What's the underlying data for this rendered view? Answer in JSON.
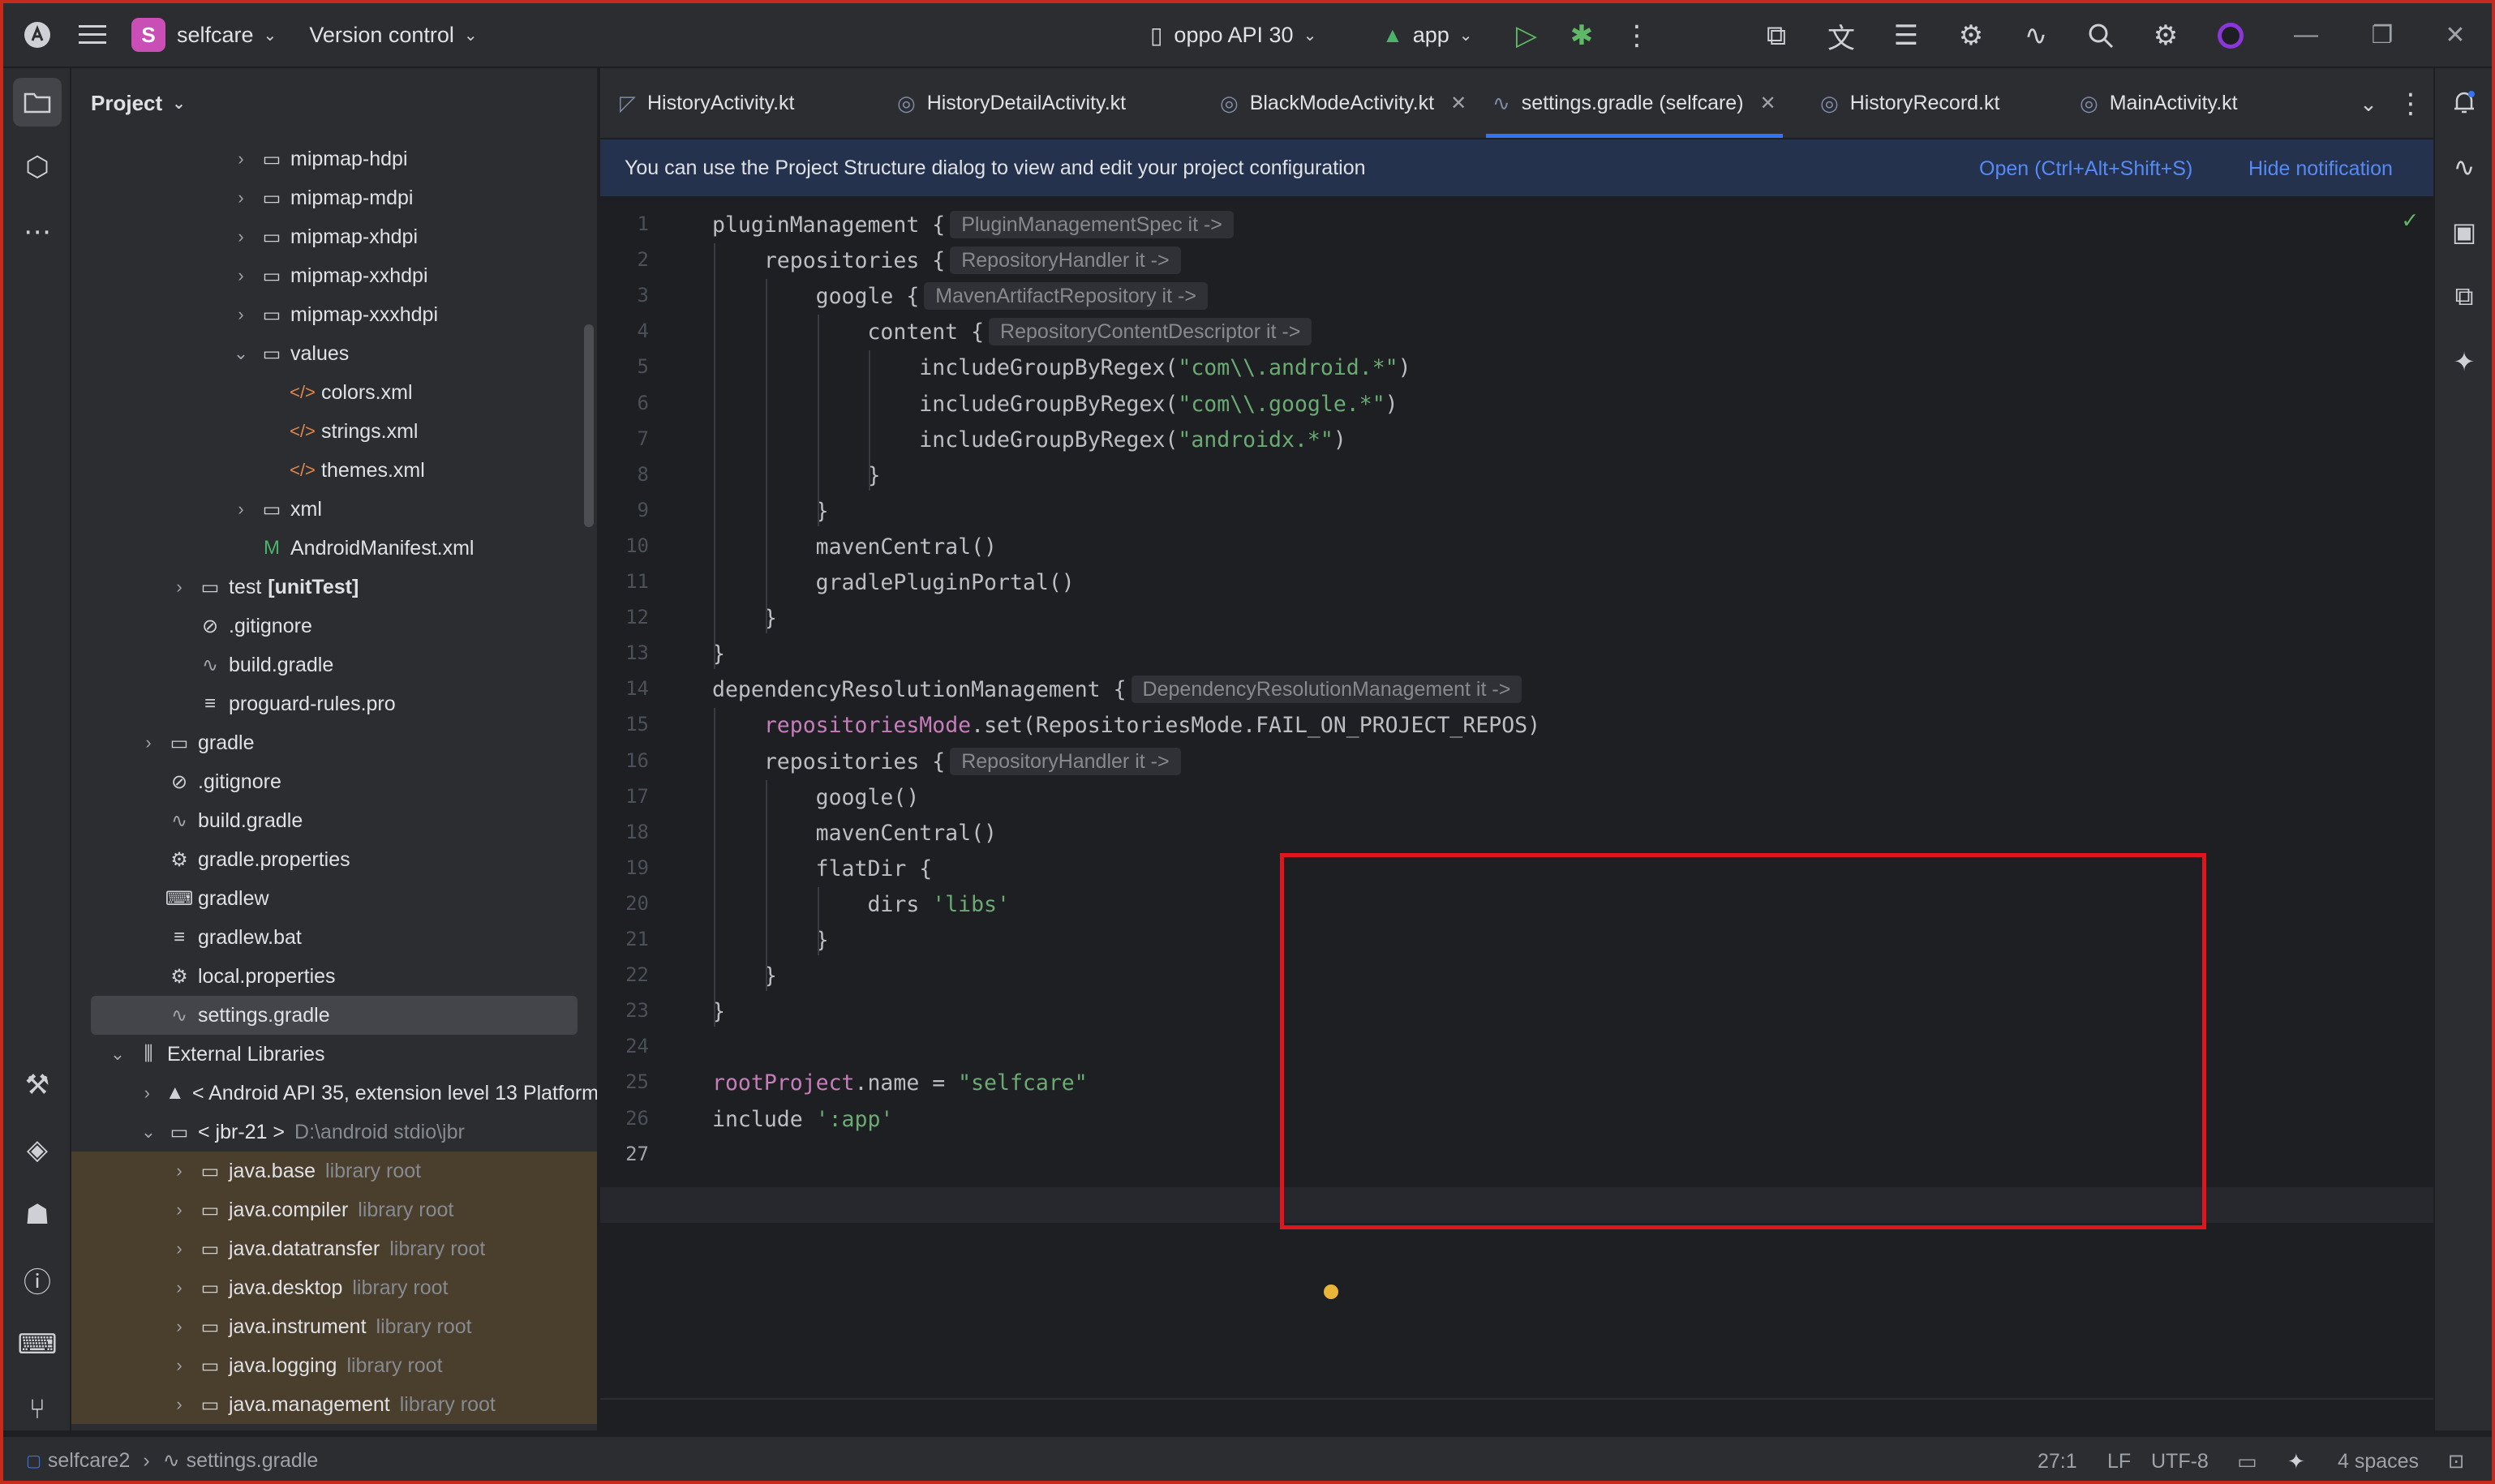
{
  "titlebar": {
    "project_initial": "S",
    "project_name": "selfcare",
    "vcs": "Version control",
    "device": "oppo API 30",
    "run_config": "app"
  },
  "project_panel": {
    "title": "Project",
    "tree": [
      {
        "label": "mipmap-hdpi",
        "icon": "folder-icon",
        "depth": 5,
        "arrow": "›"
      },
      {
        "label": "mipmap-mdpi",
        "icon": "folder-icon",
        "depth": 5,
        "arrow": "›"
      },
      {
        "label": "mipmap-xhdpi",
        "icon": "folder-icon",
        "depth": 5,
        "arrow": "›"
      },
      {
        "label": "mipmap-xxhdpi",
        "icon": "folder-icon",
        "depth": 5,
        "arrow": "›"
      },
      {
        "label": "mipmap-xxxhdpi",
        "icon": "folder-icon",
        "depth": 5,
        "arrow": "›"
      },
      {
        "label": "values",
        "icon": "folder-icon",
        "depth": 5,
        "arrow": "⌄"
      },
      {
        "label": "colors.xml",
        "icon": "xml-file-icon",
        "depth": 6,
        "arrow": ""
      },
      {
        "label": "strings.xml",
        "icon": "xml-file-icon",
        "depth": 6,
        "arrow": ""
      },
      {
        "label": "themes.xml",
        "icon": "xml-file-icon",
        "depth": 6,
        "arrow": ""
      },
      {
        "label": "xml",
        "icon": "folder-icon",
        "depth": 5,
        "arrow": "›"
      },
      {
        "label": "AndroidManifest.xml",
        "icon": "manifest-icon",
        "depth": 5,
        "arrow": ""
      },
      {
        "label": "test",
        "bold": "[unitTest]",
        "icon": "test-folder-icon",
        "depth": 3,
        "arrow": "›"
      },
      {
        "label": ".gitignore",
        "icon": "ignore-file-icon",
        "depth": 3,
        "arrow": ""
      },
      {
        "label": "build.gradle",
        "icon": "gradle-icon",
        "depth": 3,
        "arrow": ""
      },
      {
        "label": "proguard-rules.pro",
        "icon": "text-file-icon",
        "depth": 3,
        "arrow": ""
      },
      {
        "label": "gradle",
        "icon": "folder-icon",
        "depth": 2,
        "arrow": "›"
      },
      {
        "label": ".gitignore",
        "icon": "ignore-file-icon",
        "depth": 2,
        "arrow": ""
      },
      {
        "label": "build.gradle",
        "icon": "gradle-icon",
        "depth": 2,
        "arrow": ""
      },
      {
        "label": "gradle.properties",
        "icon": "settings-file-icon",
        "depth": 2,
        "arrow": ""
      },
      {
        "label": "gradlew",
        "icon": "terminal-file-icon",
        "depth": 2,
        "arrow": ""
      },
      {
        "label": "gradlew.bat",
        "icon": "text-file-icon",
        "depth": 2,
        "arrow": ""
      },
      {
        "label": "local.properties",
        "icon": "settings-file-icon",
        "depth": 2,
        "arrow": ""
      },
      {
        "label": "settings.gradle",
        "icon": "gradle-icon",
        "depth": 2,
        "arrow": "",
        "selected": true
      },
      {
        "label": "External Libraries",
        "icon": "library-icon",
        "depth": 1,
        "arrow": "⌄"
      },
      {
        "label": "< Android API 35, extension level 13 Platform",
        "icon": "android-icon",
        "depth": 2,
        "arrow": "›"
      },
      {
        "label": "< jbr-21 >",
        "hint": "D:\\android stdio\\jbr",
        "icon": "jdk-icon",
        "depth": 2,
        "arrow": "⌄"
      },
      {
        "label": "java.base",
        "hint": "library root",
        "icon": "lib-root-icon",
        "depth": 3,
        "arrow": "›",
        "lib": true
      },
      {
        "label": "java.compiler",
        "hint": "library root",
        "icon": "lib-root-icon",
        "depth": 3,
        "arrow": "›",
        "lib": true
      },
      {
        "label": "java.datatransfer",
        "hint": "library root",
        "icon": "lib-root-icon",
        "depth": 3,
        "arrow": "›",
        "lib": true
      },
      {
        "label": "java.desktop",
        "hint": "library root",
        "icon": "lib-root-icon",
        "depth": 3,
        "arrow": "›",
        "lib": true
      },
      {
        "label": "java.instrument",
        "hint": "library root",
        "icon": "lib-root-icon",
        "depth": 3,
        "arrow": "›",
        "lib": true
      },
      {
        "label": "java.logging",
        "hint": "library root",
        "icon": "lib-root-icon",
        "depth": 3,
        "arrow": "›",
        "lib": true
      },
      {
        "label": "java.management",
        "hint": "library root",
        "icon": "lib-root-icon",
        "depth": 3,
        "arrow": "›",
        "lib": true
      }
    ]
  },
  "tabs": [
    {
      "label": "HistoryActivity.kt",
      "icon": "kotlin-file-icon"
    },
    {
      "label": "HistoryDetailActivity.kt",
      "icon": "kotlin-class-icon"
    },
    {
      "label": "BlackModeActivity.kt",
      "icon": "kotlin-class-icon",
      "closable": true
    },
    {
      "label": "settings.gradle (selfcare)",
      "icon": "gradle-icon",
      "closable": true,
      "active": true
    },
    {
      "label": "HistoryRecord.kt",
      "icon": "kotlin-class-icon"
    },
    {
      "label": "MainActivity.kt",
      "icon": "kotlin-class-icon"
    }
  ],
  "notification": {
    "text": "You can use the Project Structure dialog to view and edit your project configuration",
    "action": "Open (Ctrl+Alt+Shift+S)",
    "dismiss": "Hide notification"
  },
  "code_lines": [
    {
      "n": "1",
      "indent": 0,
      "parts": [
        {
          "t": "pluginManagement {"
        }
      ],
      "inlay": "PluginManagementSpec it ->"
    },
    {
      "n": "2",
      "indent": 1,
      "parts": [
        {
          "t": "repositories {"
        }
      ],
      "inlay": "RepositoryHandler it ->"
    },
    {
      "n": "3",
      "indent": 2,
      "parts": [
        {
          "t": "google {"
        }
      ],
      "inlay": "MavenArtifactRepository it ->"
    },
    {
      "n": "4",
      "indent": 3,
      "parts": [
        {
          "t": "content {"
        }
      ],
      "inlay": "RepositoryContentDescriptor it ->"
    },
    {
      "n": "5",
      "indent": 4,
      "parts": [
        {
          "t": "includeGroupByRegex("
        },
        {
          "t": "\"com\\\\.android.*\"",
          "c": "str"
        },
        {
          "t": ")"
        }
      ]
    },
    {
      "n": "6",
      "indent": 4,
      "parts": [
        {
          "t": "includeGroupByRegex("
        },
        {
          "t": "\"com\\\\.google.*\"",
          "c": "str"
        },
        {
          "t": ")"
        }
      ]
    },
    {
      "n": "7",
      "indent": 4,
      "parts": [
        {
          "t": "includeGroupByRegex("
        },
        {
          "t": "\"androidx.*\"",
          "c": "str"
        },
        {
          "t": ")"
        }
      ]
    },
    {
      "n": "8",
      "indent": 3,
      "parts": [
        {
          "t": "}"
        }
      ]
    },
    {
      "n": "9",
      "indent": 2,
      "parts": [
        {
          "t": "}"
        }
      ]
    },
    {
      "n": "10",
      "indent": 2,
      "parts": [
        {
          "t": "mavenCentral()"
        }
      ]
    },
    {
      "n": "11",
      "indent": 2,
      "parts": [
        {
          "t": "gradlePluginPortal()"
        }
      ]
    },
    {
      "n": "12",
      "indent": 1,
      "parts": [
        {
          "t": "}"
        }
      ]
    },
    {
      "n": "13",
      "indent": 0,
      "parts": [
        {
          "t": "}"
        }
      ]
    },
    {
      "n": "14",
      "indent": 0,
      "parts": [
        {
          "t": "dependencyResolutionManagement {"
        }
      ],
      "inlay": "DependencyResolutionManagement it ->"
    },
    {
      "n": "15",
      "indent": 1,
      "parts": [
        {
          "t": "repositoriesMode",
          "c": "prop"
        },
        {
          "t": ".set(RepositoriesMode.FAIL_ON_PROJECT_REPOS)"
        }
      ]
    },
    {
      "n": "16",
      "indent": 1,
      "parts": [
        {
          "t": "repositories {"
        }
      ],
      "inlay": "RepositoryHandler it ->"
    },
    {
      "n": "17",
      "indent": 2,
      "parts": [
        {
          "t": "google()"
        }
      ]
    },
    {
      "n": "18",
      "indent": 2,
      "parts": [
        {
          "t": "mavenCentral()"
        }
      ]
    },
    {
      "n": "19",
      "indent": 2,
      "parts": [
        {
          "t": "flatDir {"
        }
      ]
    },
    {
      "n": "20",
      "indent": 3,
      "parts": [
        {
          "t": "dirs "
        },
        {
          "t": "'libs'",
          "c": "str"
        }
      ]
    },
    {
      "n": "21",
      "indent": 2,
      "parts": [
        {
          "t": "}"
        }
      ]
    },
    {
      "n": "22",
      "indent": 1,
      "parts": [
        {
          "t": "}"
        }
      ]
    },
    {
      "n": "23",
      "indent": 0,
      "parts": [
        {
          "t": "}"
        }
      ]
    },
    {
      "n": "24",
      "indent": 0,
      "parts": []
    },
    {
      "n": "25",
      "indent": 0,
      "parts": [
        {
          "t": "rootProject",
          "c": "prop"
        },
        {
          "t": ".name = "
        },
        {
          "t": "\"selfcare\"",
          "c": "str"
        }
      ]
    },
    {
      "n": "26",
      "indent": 0,
      "parts": [
        {
          "t": "include "
        },
        {
          "t": "':app'",
          "c": "str"
        }
      ]
    },
    {
      "n": "27",
      "indent": 0,
      "parts": []
    }
  ],
  "statusbar": {
    "breadcrumb_root": "selfcare2",
    "breadcrumb_file": "settings.gradle",
    "position": "27:1",
    "line_sep": "LF",
    "encoding": "UTF-8",
    "indent": "4 spaces"
  },
  "colors": {
    "accent": "#3574f0",
    "highlight_box": "#e0161f",
    "string": "#6aab73",
    "property": "#c77dbb"
  }
}
